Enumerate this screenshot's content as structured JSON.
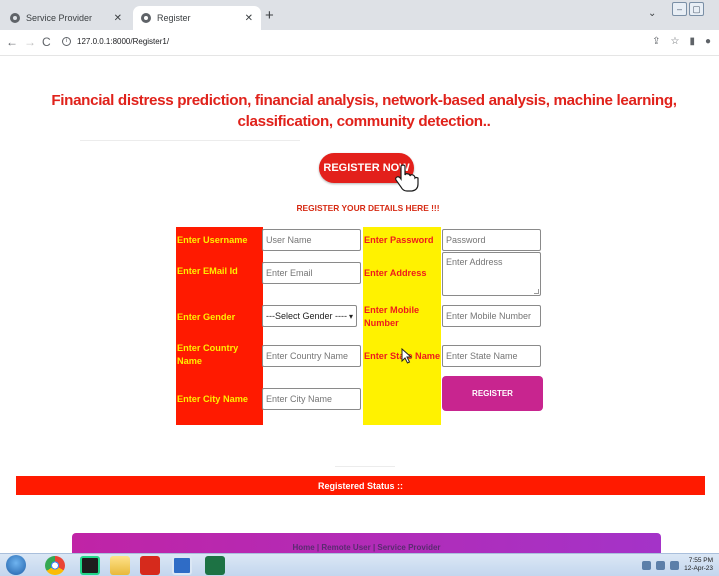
{
  "browser": {
    "tabs": [
      {
        "label": "Service Provider",
        "active": false
      },
      {
        "label": "Register",
        "active": true
      }
    ],
    "url": "127.0.0.1:8000/Register1/"
  },
  "page": {
    "headline": "Financial distress prediction, financial analysis, network-based analysis, machine learning, classification, community detection..",
    "register_now_label": "REGISTER NOW",
    "subtitle": "REGISTER YOUR DETAILS HERE !!!",
    "form": {
      "username": {
        "label": "Enter Username",
        "placeholder": "User Name"
      },
      "password": {
        "label": "Enter Password",
        "placeholder": "Password"
      },
      "email": {
        "label": "Enter EMail Id",
        "placeholder": "Enter Email"
      },
      "address": {
        "label": "Enter Address",
        "placeholder": "Enter Address"
      },
      "gender": {
        "label": "Enter Gender",
        "selected": "---Select Gender ----"
      },
      "mobile": {
        "label": "Enter Mobile Number",
        "placeholder": "Enter Mobile Number"
      },
      "country": {
        "label": "Enter Country Name",
        "placeholder": "Enter Country Name"
      },
      "state": {
        "label": "Enter State Name",
        "placeholder": "Enter State Name"
      },
      "city": {
        "label": "Enter City Name",
        "placeholder": "Enter City Name"
      },
      "submit_label": "REGISTER"
    },
    "status_label": "Registered Status ::",
    "footer_text": "Home | Remote User | Service Provider"
  },
  "taskbar": {
    "clock_time": "7:55 PM",
    "clock_date": "12-Apr-23"
  },
  "colors": {
    "accent_red": "#ff1a00",
    "label_yellow": "#fff200",
    "register_button": "#c8258f"
  },
  "icons": [
    "search-icon",
    "share-icon",
    "star-icon",
    "sidebar-icon",
    "profile-icon",
    "hand-pointer-icon",
    "cursor-icon"
  ]
}
